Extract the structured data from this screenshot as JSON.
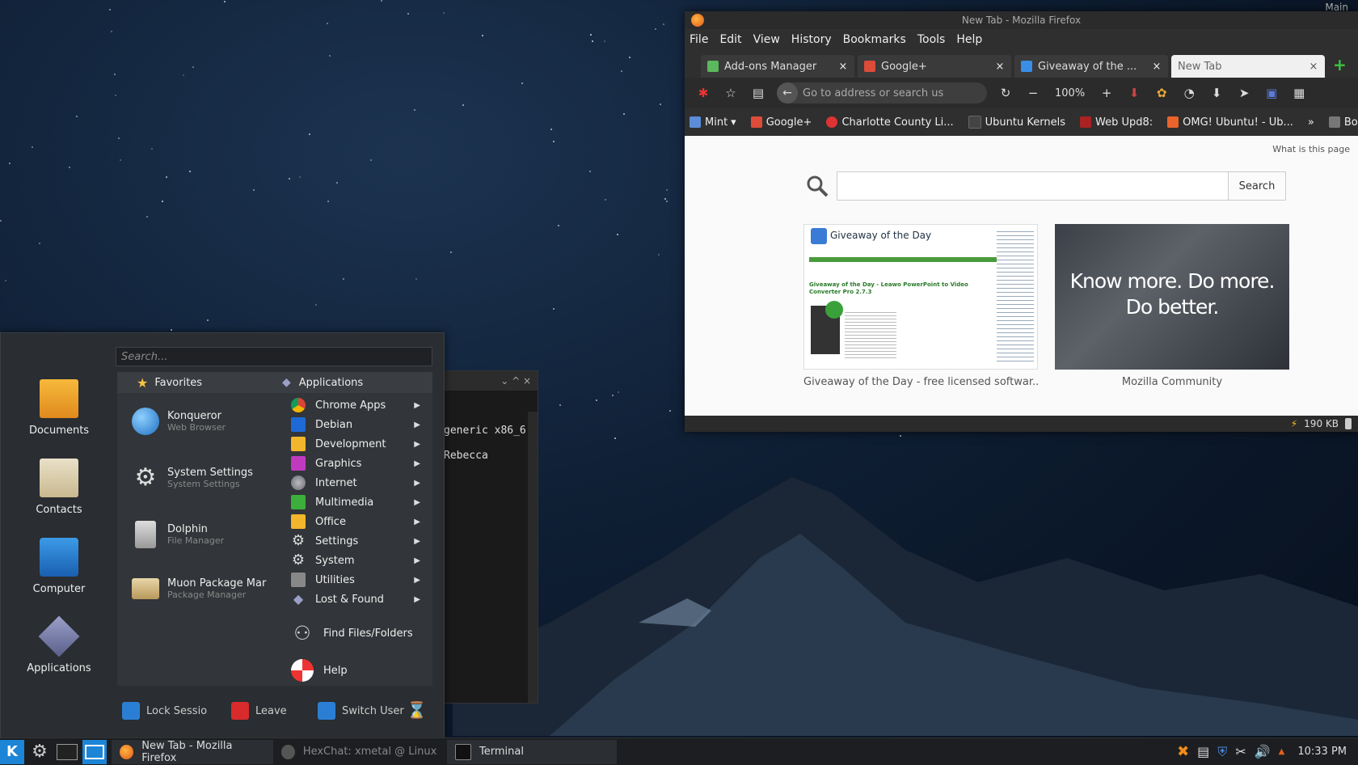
{
  "firefox": {
    "title": "New Tab - Mozilla Firefox",
    "menu": [
      "File",
      "Edit",
      "View",
      "History",
      "Bookmarks",
      "Tools",
      "Help"
    ],
    "tabs": [
      {
        "label": "Add-ons Manager",
        "close": "×"
      },
      {
        "label": "Google+",
        "close": "×"
      },
      {
        "label": "Giveaway of the ...",
        "close": "×"
      },
      {
        "label": "New Tab",
        "close": "×"
      }
    ],
    "new_tab": "+",
    "url_placeholder": "Go to address or search us",
    "zoom": "100%",
    "zoom_out": "−",
    "zoom_in": "+",
    "bookmarks": [
      "Mint",
      "Google+",
      "Charlotte County Li...",
      "Ubuntu Kernels",
      "Web Upd8:",
      "OMG! Ubuntu! - Ub...",
      "»",
      "Bo"
    ],
    "whats_this": "What is this page",
    "search_button": "Search",
    "tiles": [
      {
        "caption": "Giveaway of the Day - free licensed softwar...",
        "header": "Giveaway of the Day",
        "headline": "Giveaway of the Day - Leawo PowerPoint to Video Converter Pro 2.7.3"
      },
      {
        "caption": "Mozilla Community",
        "slogan_line1": "Know more. Do more.",
        "slogan_line2": "Do better."
      }
    ],
    "status_size": "190 KB"
  },
  "terminal": {
    "lines": [
      "generic x86_6",
      "",
      "Rebecca"
    ],
    "controls": "⌄ ^ ×"
  },
  "kmenu": {
    "search_placeholder": "Search...",
    "sidebar": [
      "Documents",
      "Contacts",
      "Computer",
      "Applications"
    ],
    "favorites_header": "Favorites",
    "applications_header": "Applications",
    "favorites": [
      {
        "name": "Konqueror",
        "desc": "Web Browser"
      },
      {
        "name": "System Settings",
        "desc": "System Settings"
      },
      {
        "name": "Dolphin",
        "desc": "File Manager"
      },
      {
        "name": "Muon Package Mar",
        "desc": "Package Manager"
      }
    ],
    "categories": [
      "Chrome Apps",
      "Debian",
      "Development",
      "Graphics",
      "Internet",
      "Multimedia",
      "Office",
      "Settings",
      "System",
      "Utilities",
      "Lost & Found"
    ],
    "find_files": "Find Files/Folders",
    "help": "Help",
    "footer": {
      "lock": "Lock Sessio",
      "leave": "Leave",
      "switch": "Switch User"
    }
  },
  "taskbar": {
    "tasks": [
      "New Tab - Mozilla Firefox",
      "HexChat: xmetal @ Linux Mint",
      "Terminal"
    ],
    "clock": "10:33 PM",
    "top_right_label": "Main"
  },
  "colors": {
    "accent": "#e2571a",
    "kde_blue": "#1d85d6",
    "menu_bg": "#2a2d31"
  }
}
